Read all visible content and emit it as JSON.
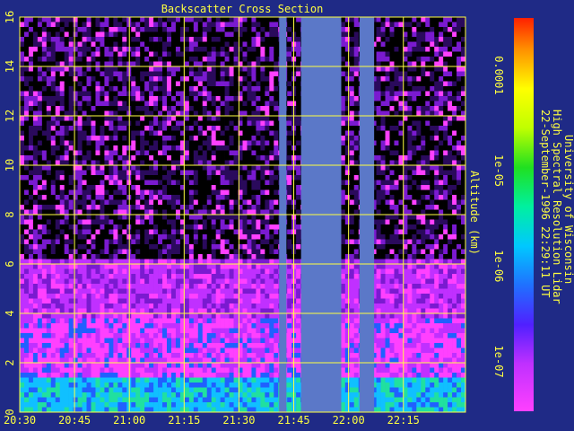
{
  "colors": {
    "background": "#1f2a86",
    "axis": "#ffff40",
    "grid": "#ffff40",
    "gap": "#5b78c8"
  },
  "chart_data": {
    "type": "heatmap",
    "title": "Backscatter Cross Section",
    "ylabel": "Altitude (km)",
    "xlabel": "",
    "y_ticks": [
      "0",
      "2",
      "4",
      "6",
      "8",
      "10",
      "12",
      "14",
      "16"
    ],
    "ylim": [
      0,
      16
    ],
    "x_ticks": [
      "20:30",
      "20:45",
      "21:00",
      "21:15",
      "21:30",
      "21:45",
      "22:00",
      "22:15"
    ],
    "x_range_minutes": [
      1230,
      1352
    ],
    "grid": true,
    "data_gaps": [
      {
        "start": "21:41",
        "end": "21:43"
      },
      {
        "start": "21:47",
        "end": "21:58"
      },
      {
        "start": "22:03",
        "end": "22:07"
      }
    ],
    "colorbar": {
      "scale": "log",
      "range": [
        3e-08,
        0.0004
      ],
      "ticks": [
        "1e-07",
        "1e-06",
        "1e-05",
        "0.0001"
      ]
    },
    "side_text": [
      "University of Wisconsin",
      "High Spectral Resolution Lidar",
      "22-September-1996 22:29:11 UT"
    ]
  }
}
